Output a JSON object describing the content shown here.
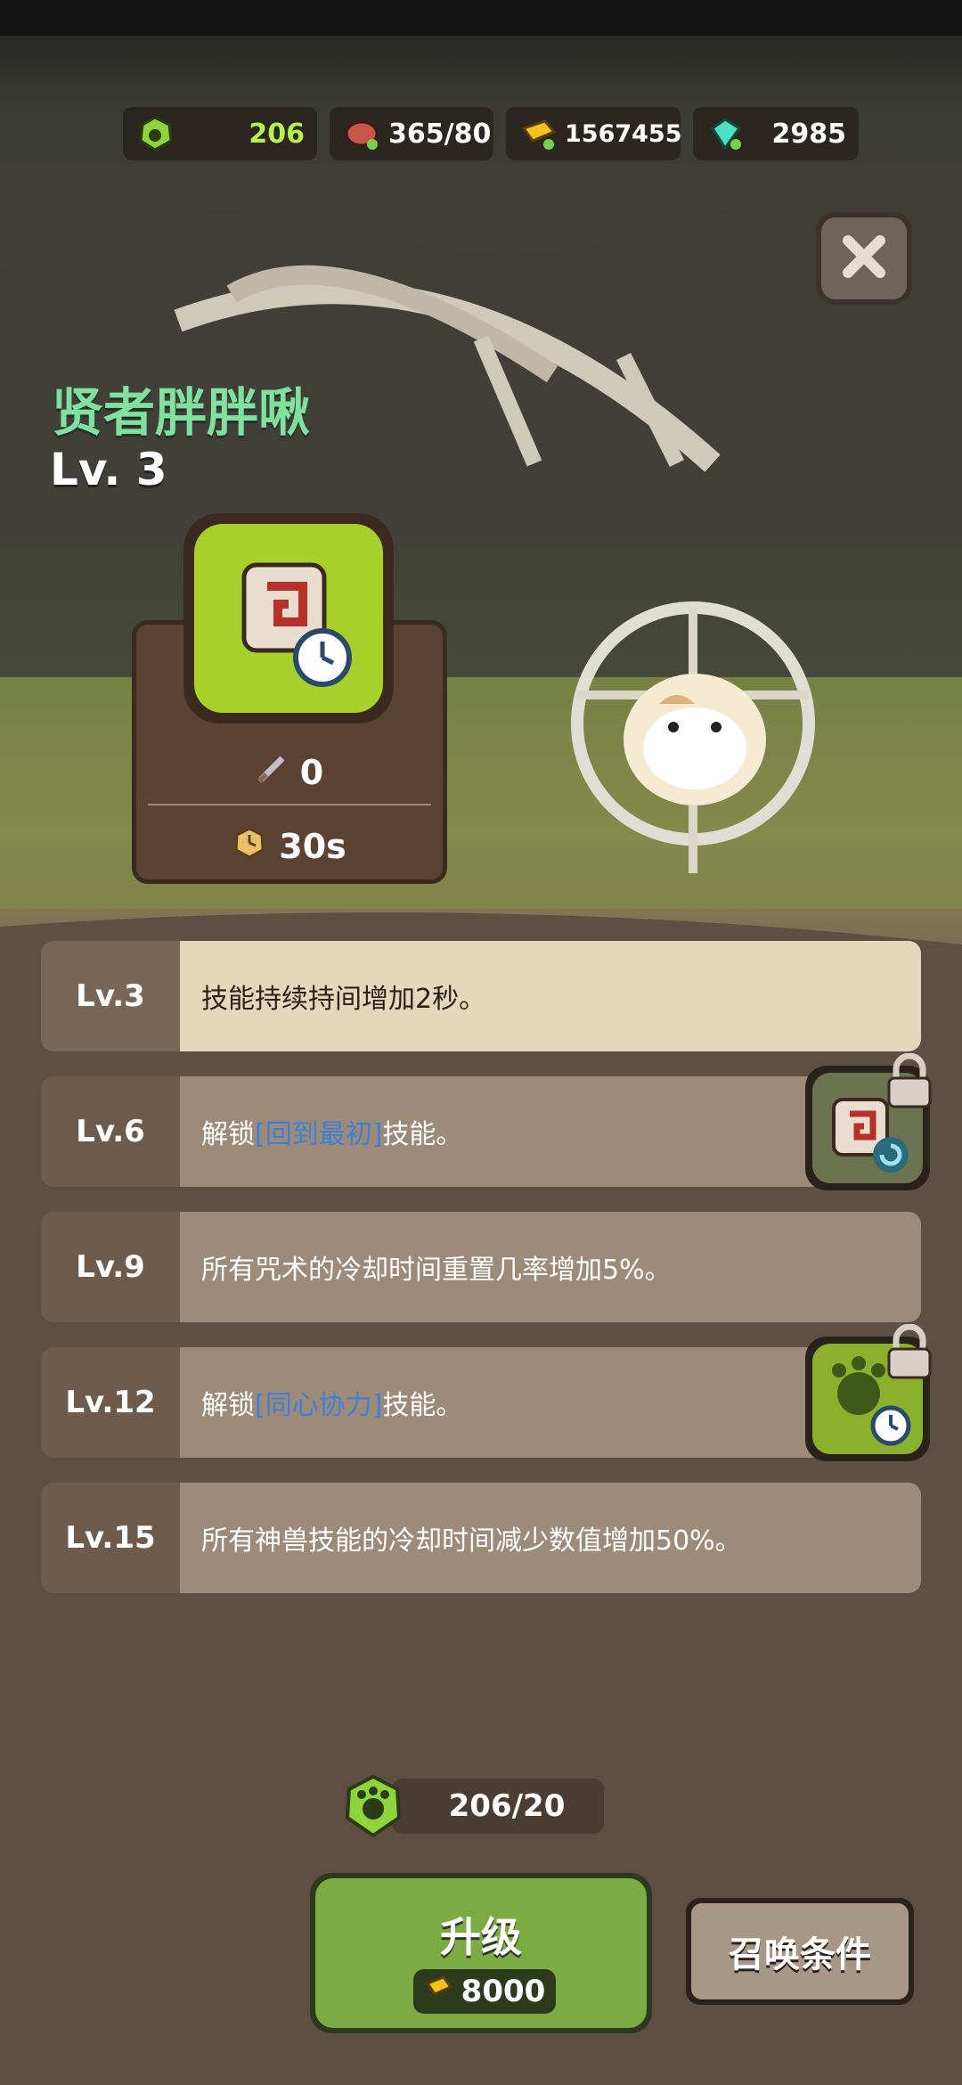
{
  "resources": [
    {
      "name": "paw-token",
      "value": "206",
      "color": "#b6f04a"
    },
    {
      "name": "meat",
      "value": "365/80",
      "color": "#ffffff"
    },
    {
      "name": "gold",
      "value": "1567455",
      "color": "#ffffff"
    },
    {
      "name": "gem",
      "value": "2985",
      "color": "#ffffff"
    }
  ],
  "character": {
    "name": "贤者胖胖啾",
    "level": "Lv. 3"
  },
  "skill": {
    "attack": "0",
    "cooldown": "30s"
  },
  "levels": [
    {
      "lv": "Lv.3",
      "text": "技能持续持间增加2秒。",
      "active": true
    },
    {
      "lv": "Lv.6",
      "pre": "解锁",
      "hl": "[回到最初]",
      "post": "技能。"
    },
    {
      "lv": "Lv.9",
      "text": "所有咒术的冷却时间重置几率增加5%。"
    },
    {
      "lv": "Lv.12",
      "pre": "解锁",
      "hl": "[同心协力]",
      "post": "技能。"
    },
    {
      "lv": "Lv.15",
      "text": "所有神兽技能的冷却时间减少数值增加50%。"
    }
  ],
  "cost": {
    "value": "206/20"
  },
  "upgrade": {
    "label": "升级",
    "price": "8000"
  },
  "summon": {
    "label": "召唤条件"
  },
  "colors": {
    "accent_green": "#7cab43",
    "title_green": "#7fe0a0",
    "highlight_blue": "#3d80d8"
  }
}
